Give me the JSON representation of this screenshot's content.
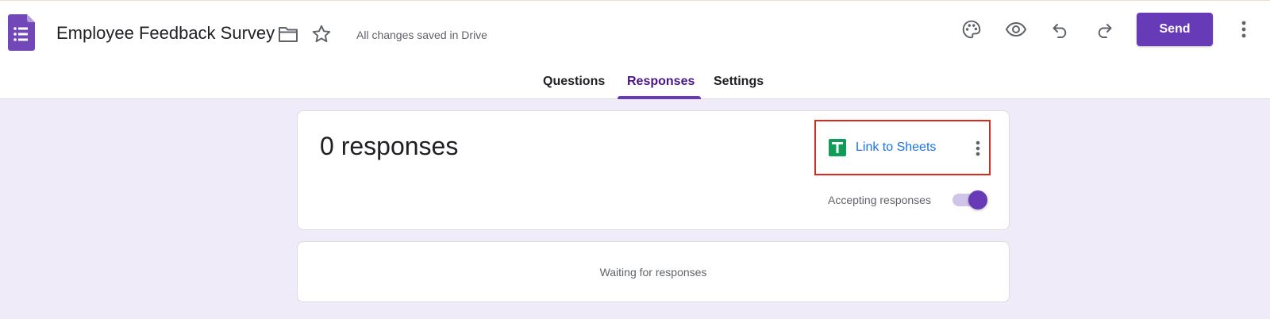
{
  "header": {
    "doc_title": "Employee Feedback Survey",
    "save_status": "All changes saved in Drive",
    "send_label": "Send",
    "icons": [
      "forms-logo",
      "folder-icon",
      "star-icon",
      "palette-icon",
      "preview-eye-icon",
      "undo-icon",
      "redo-icon",
      "more-vert-icon"
    ]
  },
  "tabs": [
    {
      "label": "Questions",
      "active": false
    },
    {
      "label": "Responses",
      "active": true
    },
    {
      "label": "Settings",
      "active": false
    }
  ],
  "summary": {
    "count_text": "0 responses",
    "link_sheets_label": "Link to Sheets",
    "accepting_label": "Accepting responses",
    "accepting_on": true
  },
  "waiting": {
    "message": "Waiting for responses"
  },
  "colors": {
    "accent": "#673ab7",
    "background": "#f0ebf8",
    "link": "#1a73e8",
    "highlight_box": "#e1251b",
    "sheets_green": "#0f9d58"
  }
}
